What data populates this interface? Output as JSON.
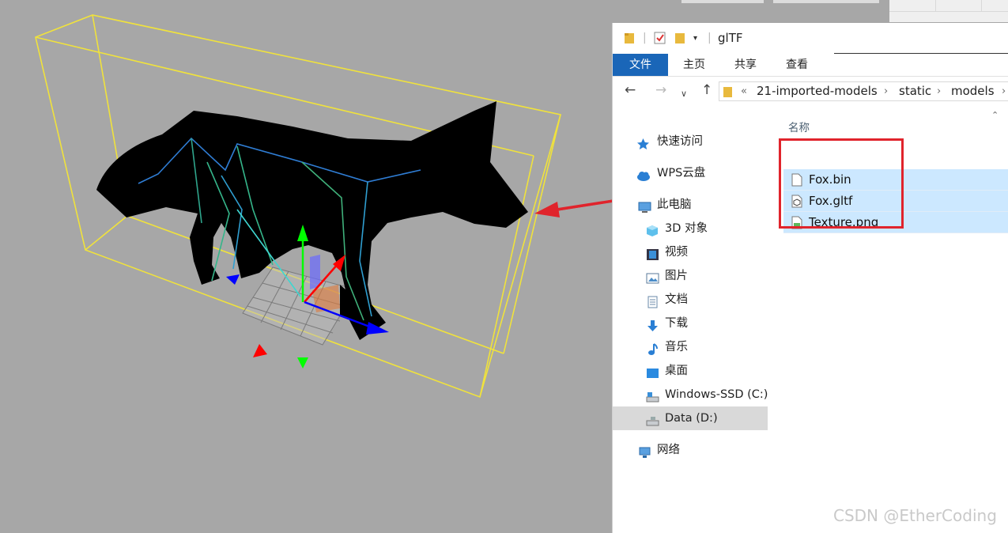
{
  "viewport": {
    "model_name": "fox",
    "colors": {
      "background": "#a7a7a7",
      "bounding_box": "#f0e23c",
      "model": "#000000",
      "axis_x": "#ff0000",
      "axis_y": "#00ff00",
      "axis_z": "#0000ff",
      "annotation_arrow": "#e0242c"
    }
  },
  "explorer": {
    "title": "glTF",
    "ribbon_tabs": [
      "文件",
      "主页",
      "共享",
      "查看"
    ],
    "active_tab": "文件",
    "address": {
      "prefix": "«",
      "segments": [
        "21-imported-models",
        "static",
        "models"
      ]
    },
    "nav_buttons": [
      "back-arrow-icon",
      "forward-arrow-icon",
      "recent-dropdown-icon",
      "up-arrow-icon"
    ],
    "nav_items": [
      {
        "label": "快速访问",
        "icon": "star-icon"
      },
      {
        "label": "WPS云盘",
        "icon": "cloud-icon"
      },
      {
        "label": "此电脑",
        "icon": "computer-icon"
      },
      {
        "label": "3D 对象",
        "icon": "cube-icon"
      },
      {
        "label": "视频",
        "icon": "video-icon"
      },
      {
        "label": "图片",
        "icon": "picture-icon"
      },
      {
        "label": "文档",
        "icon": "document-icon"
      },
      {
        "label": "下载",
        "icon": "download-icon"
      },
      {
        "label": "音乐",
        "icon": "music-icon"
      },
      {
        "label": "桌面",
        "icon": "desktop-icon"
      },
      {
        "label": "Windows-SSD (C:)",
        "icon": "drive-icon"
      },
      {
        "label": "Data (D:)",
        "icon": "drive-icon"
      },
      {
        "label": "网络",
        "icon": "network-icon"
      }
    ],
    "selected_nav": "Data (D:)",
    "column_header": "名称",
    "files": [
      {
        "name": "Fox.bin",
        "icon": "file-icon"
      },
      {
        "name": "Fox.gltf",
        "icon": "gltf-file-icon"
      },
      {
        "name": "Texture.png",
        "icon": "image-file-icon"
      }
    ],
    "colors": {
      "accent": "#1a66b8",
      "selection": "#cce8ff",
      "nav_selected": "#d9d9d9"
    }
  },
  "watermark": "CSDN @EtherCoding"
}
